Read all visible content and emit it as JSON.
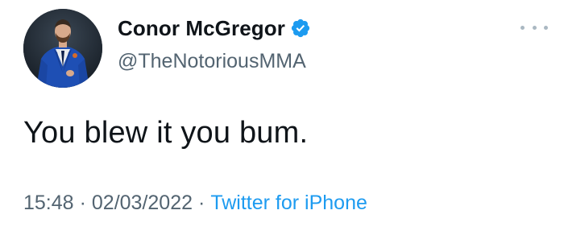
{
  "tweet": {
    "author": {
      "display_name": "Conor McGregor",
      "handle": "@TheNotoriousMMA",
      "verified_icon": "verified-badge-icon",
      "avatar_icon": "avatar"
    },
    "text": "You blew it you bum.",
    "meta": {
      "time": "15:48",
      "separator": "·",
      "date": "02/03/2022",
      "source": "Twitter for iPhone"
    },
    "more_icon": "more-options-icon"
  },
  "colors": {
    "text": "#0f1419",
    "secondary": "#536471",
    "accent": "#1d9bf0",
    "background": "#ffffff"
  }
}
